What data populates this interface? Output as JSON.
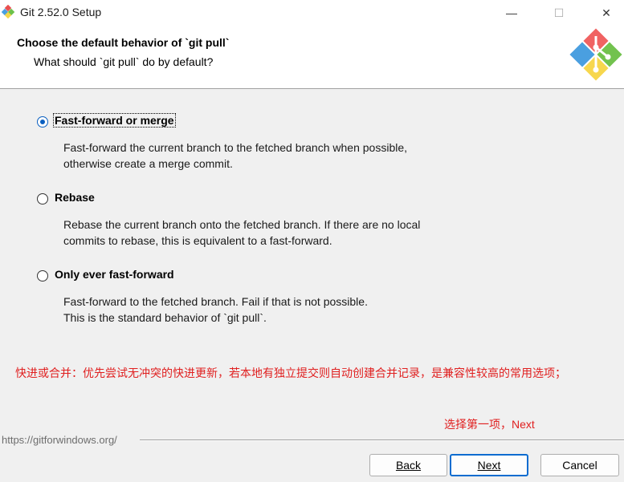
{
  "window": {
    "title": "Git 2.52.0 Setup",
    "minimize_glyph": "—",
    "maximize_glyph": "☐",
    "close_glyph": "✕"
  },
  "header": {
    "title": "Choose the default behavior of `git pull`",
    "subtitle": "What should `git pull` do by default?"
  },
  "options": [
    {
      "label": "Fast-forward or merge",
      "selected": true,
      "desc_line1": "Fast-forward the current branch to the fetched branch when possible,",
      "desc_line2": "otherwise create a merge commit."
    },
    {
      "label": "Rebase",
      "selected": false,
      "desc_line1": "Rebase the current branch onto the fetched branch. If there are no local",
      "desc_line2": "commits to rebase, this is equivalent to a fast-forward."
    },
    {
      "label": "Only ever fast-forward",
      "selected": false,
      "desc_line1": "Fast-forward to the fetched branch. Fail if that is not possible.",
      "desc_line2": "This is the standard behavior of `git pull`."
    }
  ],
  "annotations": {
    "note": "快进或合并：优先尝试无冲突的快进更新，若本地有独立提交则自动创建合并记录，是兼容性较高的常用选项；",
    "choice": "选择第一项，Next"
  },
  "footer": {
    "link": "https://gitforwindows.org/",
    "back_label": "Back",
    "next_label": "Next",
    "cancel_label": "Cancel"
  },
  "colors": {
    "accent": "#0a6cd0",
    "annotation": "#e02020"
  }
}
